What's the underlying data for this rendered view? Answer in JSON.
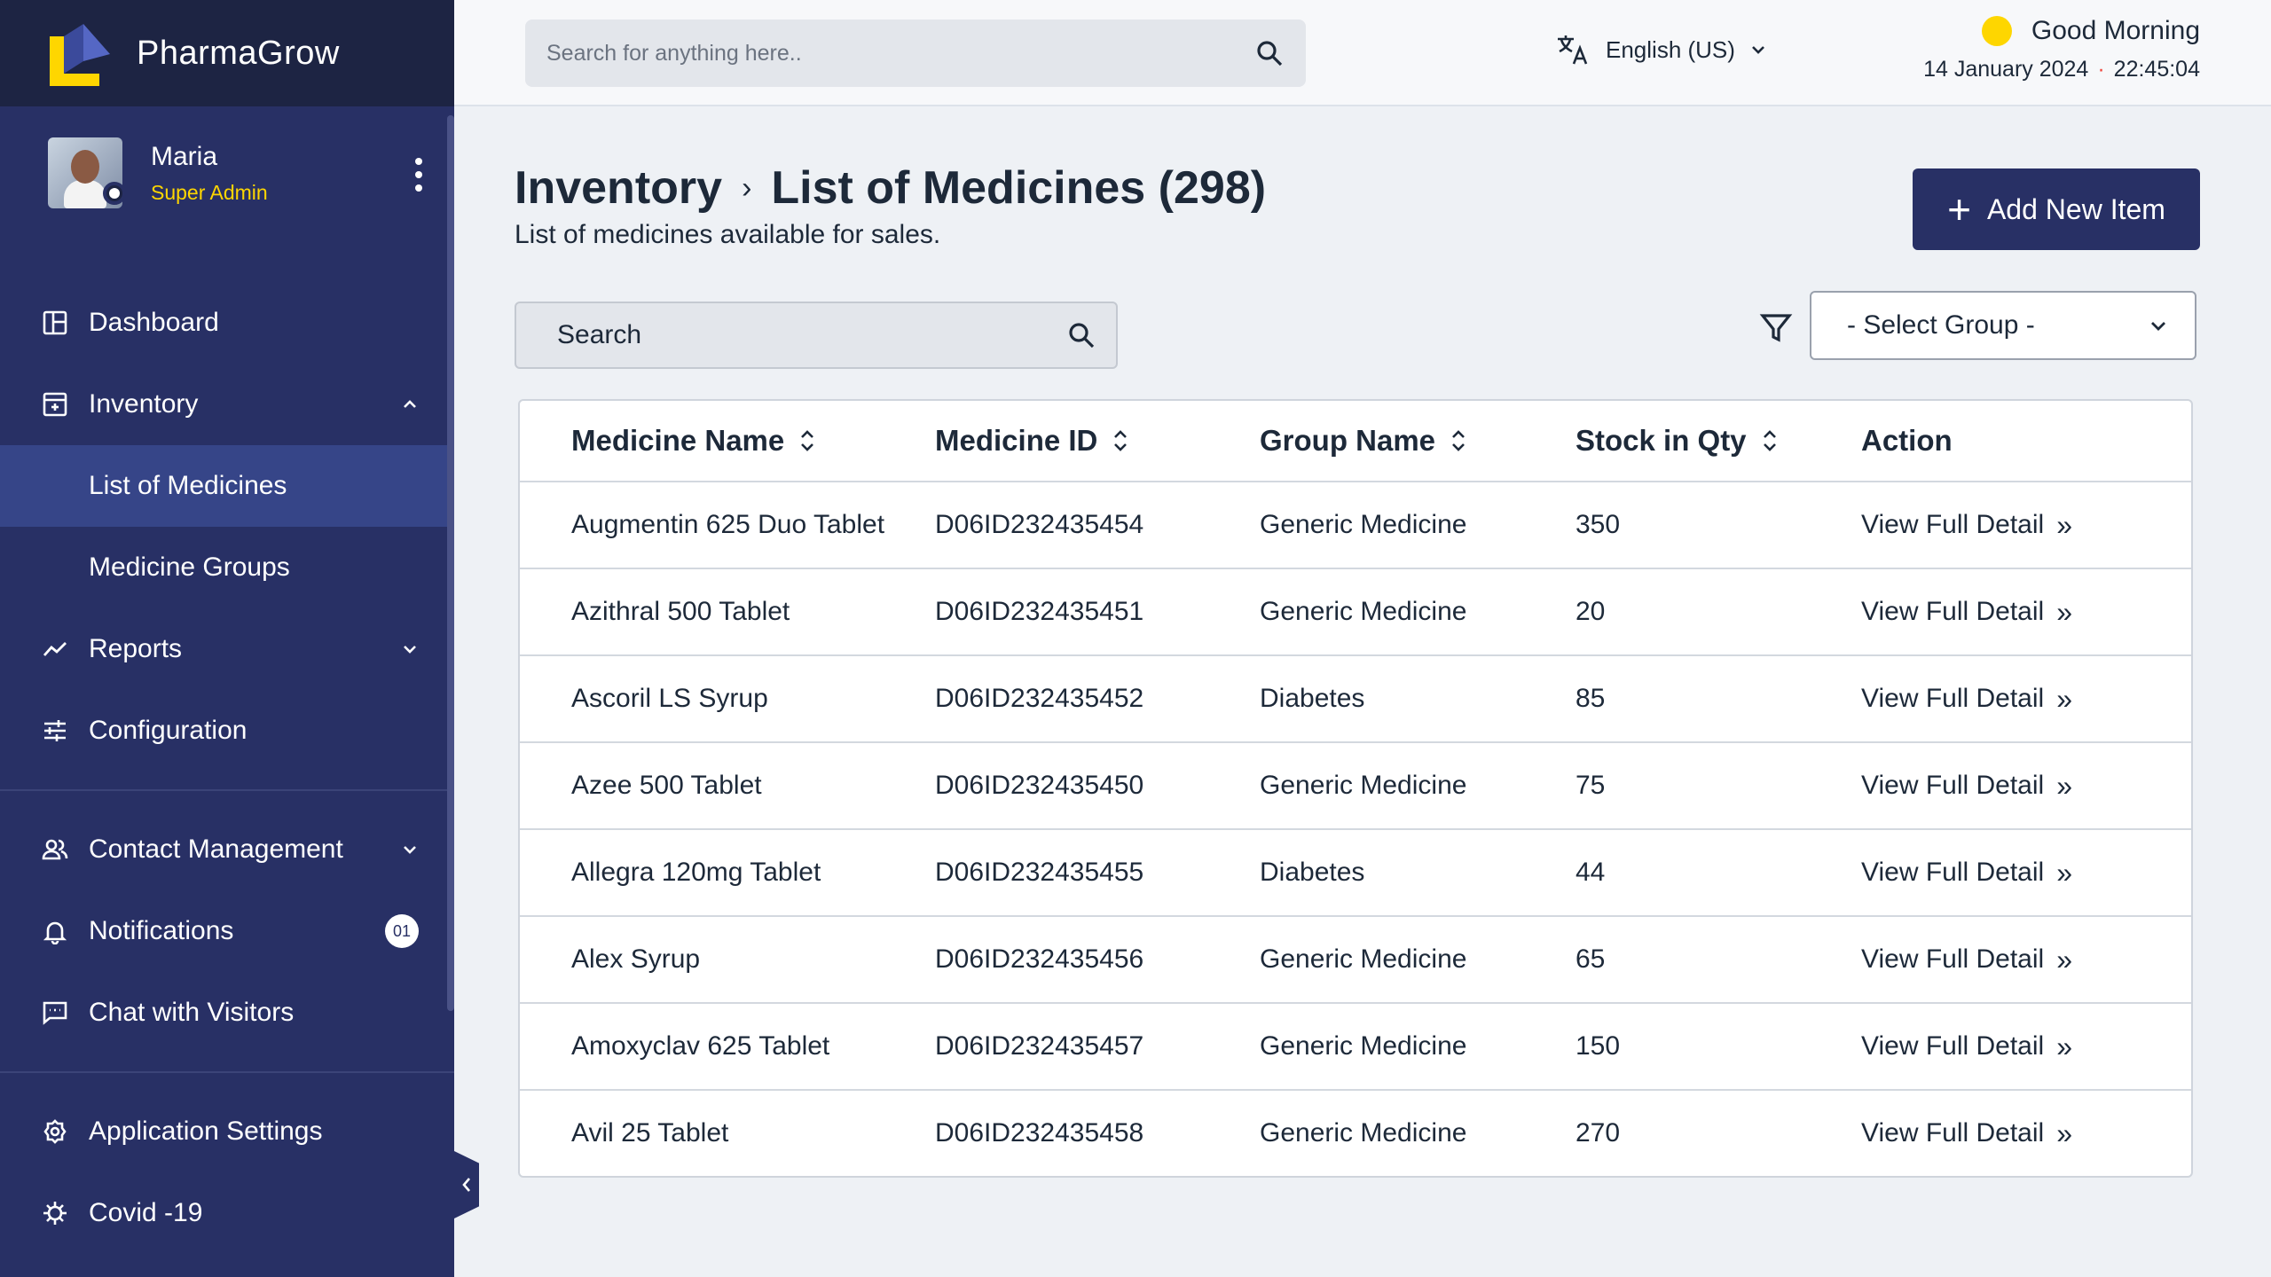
{
  "app": {
    "name": "PharmaGrow"
  },
  "profile": {
    "name": "Maria",
    "role": "Super Admin"
  },
  "sidebar": {
    "items": [
      {
        "label": "Dashboard",
        "icon": "dashboard-icon"
      },
      {
        "label": "Inventory",
        "icon": "inventory-icon",
        "expanded": true
      },
      {
        "label": "List of Medicines",
        "sub": true,
        "active": true
      },
      {
        "label": "Medicine Groups",
        "sub": true
      },
      {
        "label": "Reports",
        "icon": "reports-icon"
      },
      {
        "label": "Configuration",
        "icon": "configuration-icon"
      },
      {
        "label": "Contact Management",
        "icon": "contacts-icon"
      },
      {
        "label": "Notifications",
        "icon": "bell-icon",
        "badge": "01"
      },
      {
        "label": "Chat with Visitors",
        "icon": "chat-icon"
      },
      {
        "label": "Application Settings",
        "icon": "gear-icon"
      },
      {
        "label": "Covid -19",
        "icon": "virus-icon"
      }
    ]
  },
  "topbar": {
    "search_placeholder": "Search for anything here..",
    "language": "English (US)",
    "greeting": "Good Morning",
    "date": "14 January 2024",
    "time": "22:45:04"
  },
  "main": {
    "breadcrumb_root": "Inventory",
    "breadcrumb_current": "List of Medicines (298)",
    "subtitle": "List of medicines available for sales.",
    "add_button": "Add New Item",
    "search_placeholder": "Search",
    "select_group": "- Select Group -"
  },
  "table": {
    "headers": [
      "Medicine Name",
      "Medicine ID",
      "Group Name",
      "Stock in Qty",
      "Action"
    ],
    "rows": [
      [
        "Augmentin 625 Duo Tablet",
        "D06ID232435454",
        "Generic Medicine",
        "350",
        "View Full Detail"
      ],
      [
        "Azithral 500 Tablet",
        "D06ID232435451",
        "Generic Medicine",
        "20",
        "View Full Detail"
      ],
      [
        "Ascoril LS Syrup",
        "D06ID232435452",
        "Diabetes",
        "85",
        "View Full Detail"
      ],
      [
        "Azee 500 Tablet",
        "D06ID232435450",
        "Generic Medicine",
        "75",
        "View Full Detail"
      ],
      [
        "Allegra 120mg Tablet",
        "D06ID232435455",
        "Diabetes",
        "44",
        "View Full Detail"
      ],
      [
        "Alex Syrup",
        "D06ID232435456",
        "Generic Medicine",
        "65",
        "View Full Detail"
      ],
      [
        "Amoxyclav 625 Tablet",
        "D06ID232435457",
        "Generic Medicine",
        "150",
        "View Full Detail"
      ],
      [
        "Avil 25 Tablet",
        "D06ID232435458",
        "Generic Medicine",
        "270",
        "View Full Detail"
      ]
    ]
  },
  "colors": {
    "sidebar": "#283065",
    "brand_bar": "#1d2443",
    "active": "#364588",
    "accent_yellow": "#fed600"
  }
}
